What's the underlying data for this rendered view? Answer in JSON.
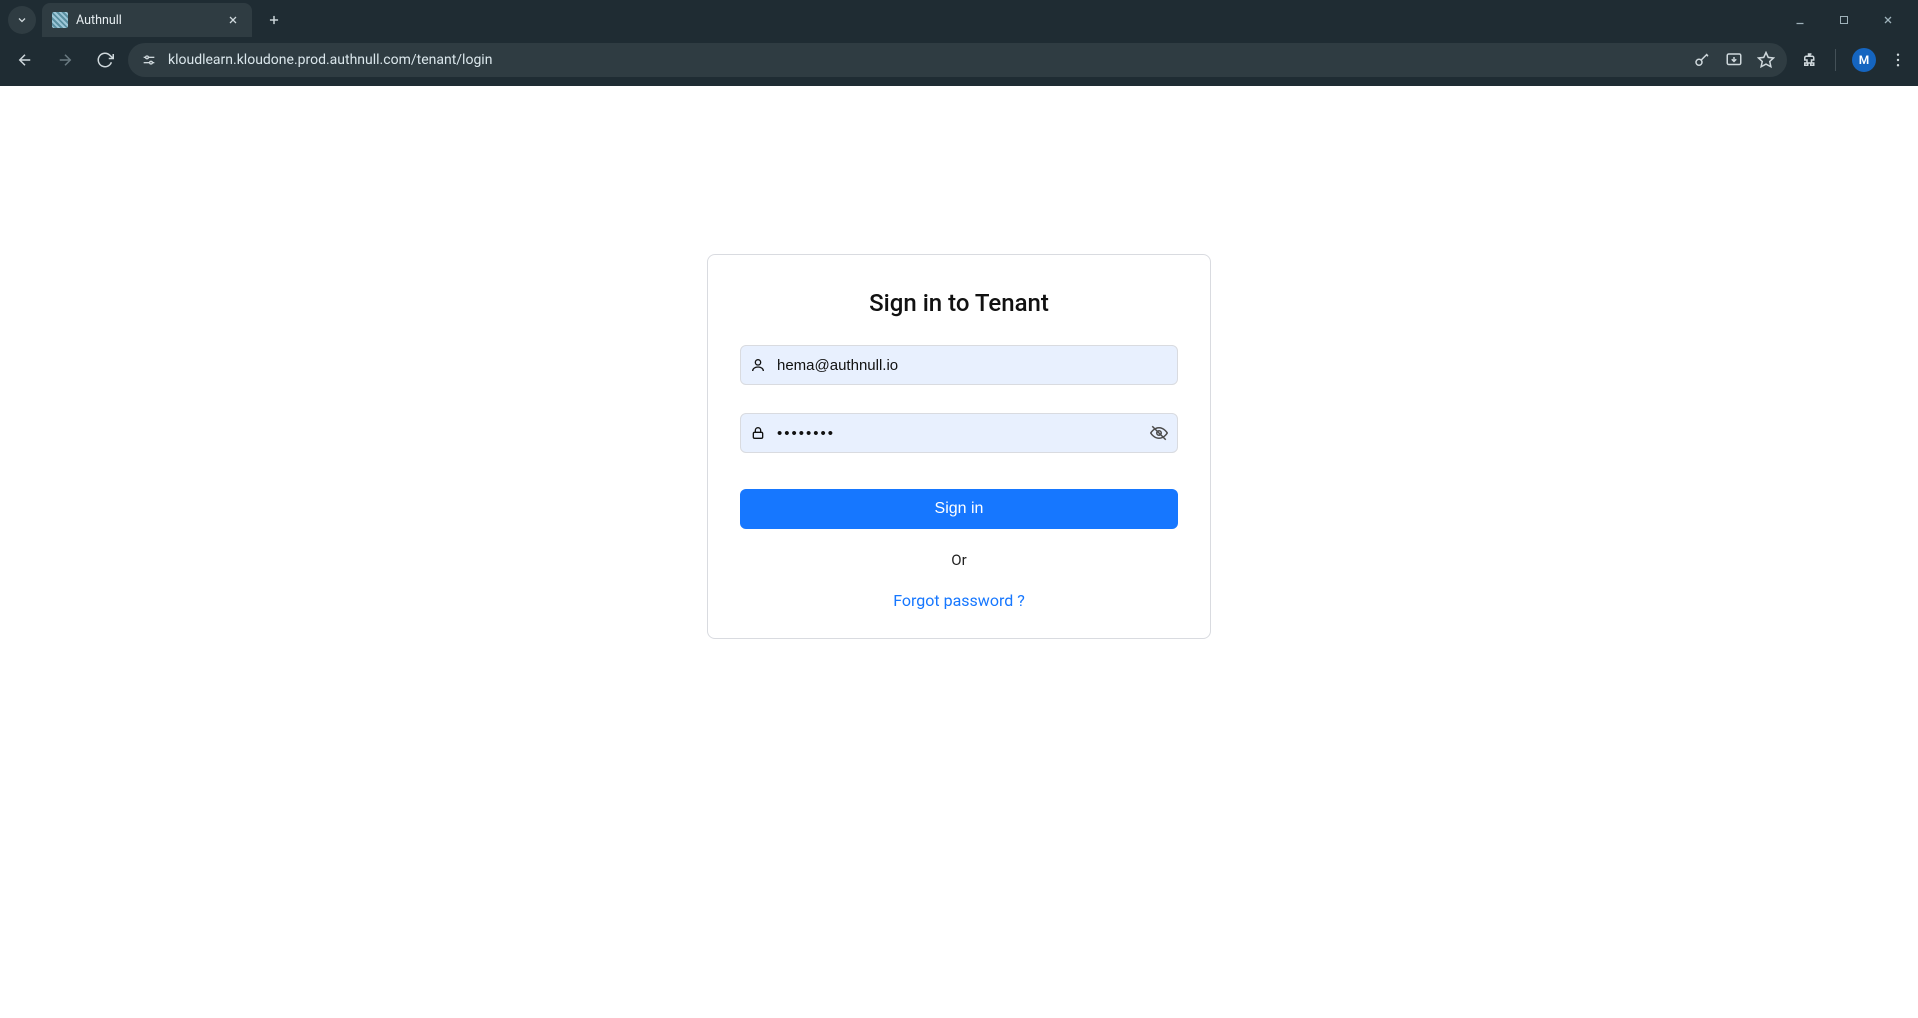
{
  "browser": {
    "tab_title": "Authnull",
    "url": "kloudlearn.kloudone.prod.authnull.com/tenant/login",
    "profile_initial": "M"
  },
  "login": {
    "heading": "Sign in to Tenant",
    "email_value": "hema@authnull.io",
    "email_placeholder": "",
    "password_masked": "········",
    "password_placeholder": "",
    "submit_label": "Sign in",
    "divider_label": "Or",
    "forgot_label": "Forgot password ?"
  },
  "icons": {
    "user": "user-icon",
    "lock": "lock-icon",
    "eye_off": "eye-off-icon"
  }
}
